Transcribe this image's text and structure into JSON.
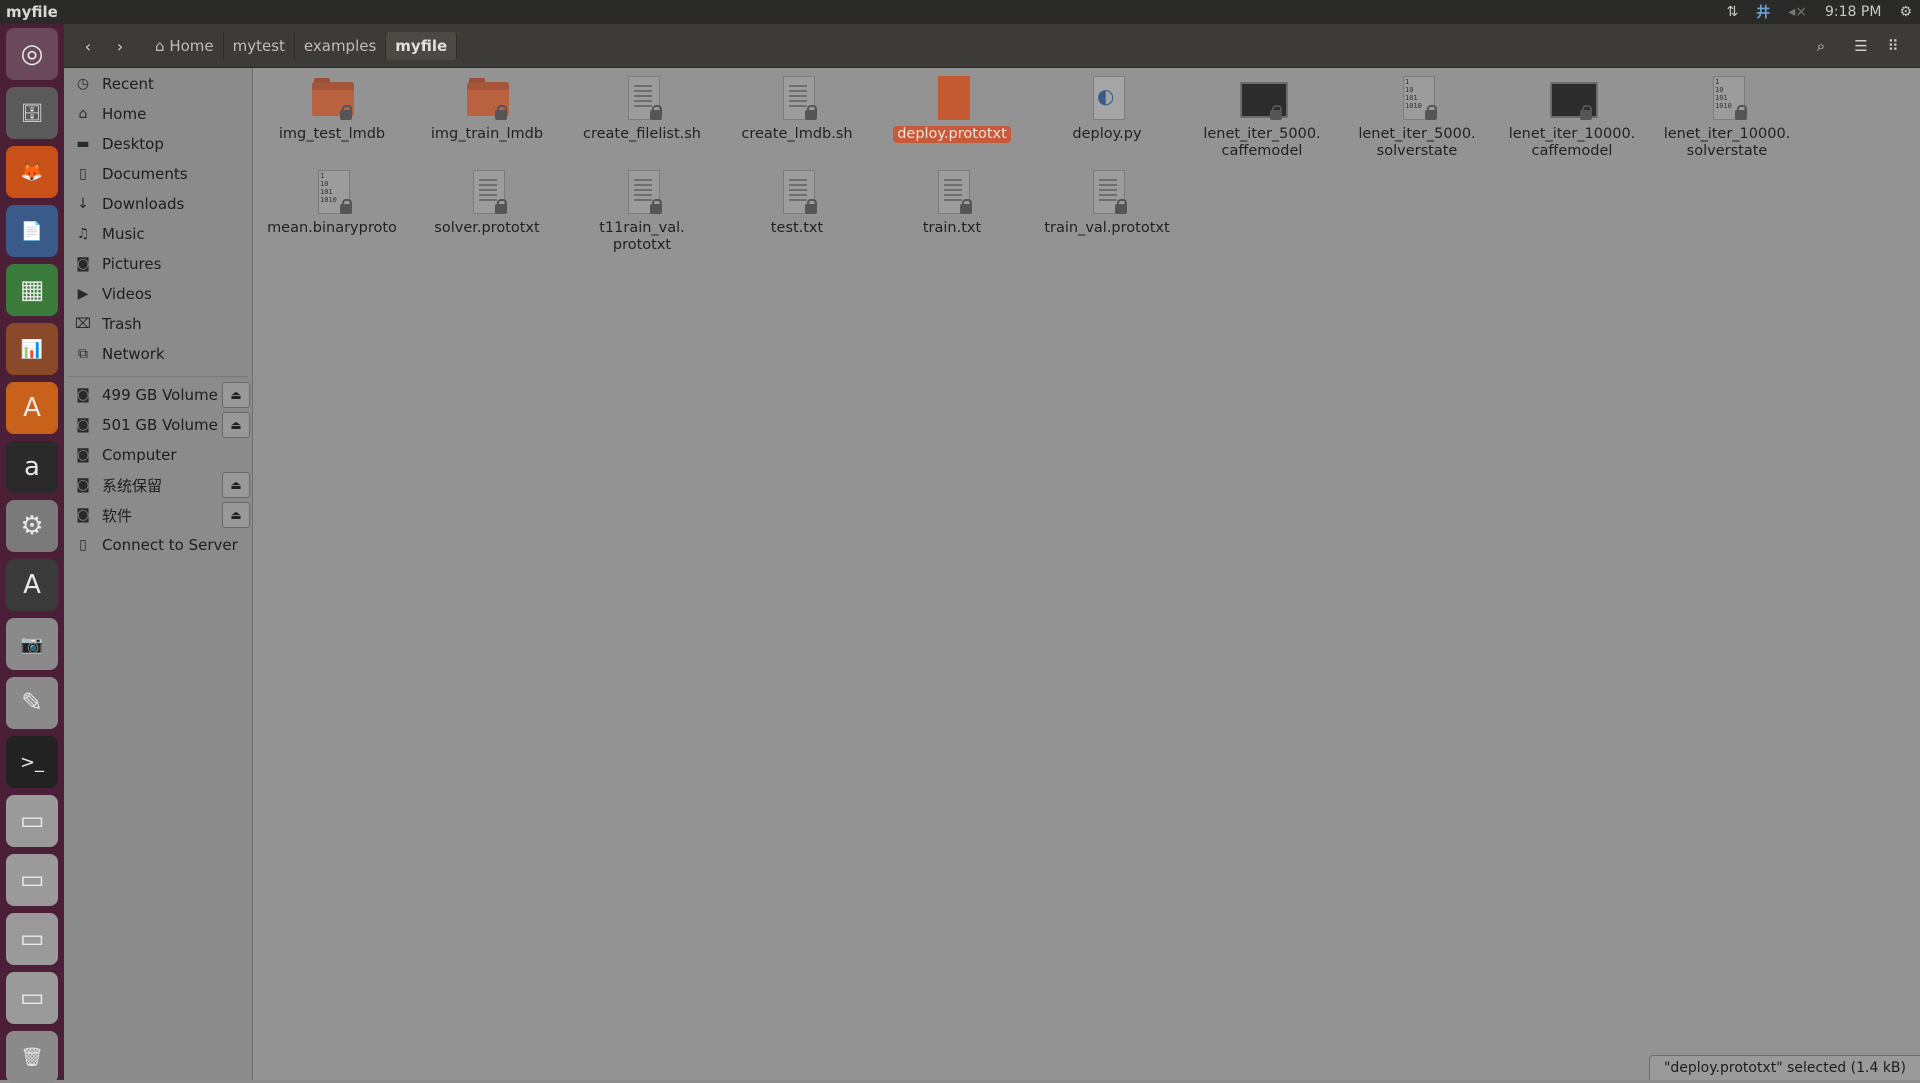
{
  "window": {
    "title": "myfile"
  },
  "tray": {
    "network_icon": "network-updown-icon",
    "input_icon": "keyboard-input-icon",
    "sound_icon": "sound-muted-icon",
    "time": "9:18 PM",
    "settings_icon": "gear-icon"
  },
  "launcher": {
    "items": [
      {
        "name": "ubuntu-dash-icon",
        "glyph": "◎"
      },
      {
        "name": "files-icon",
        "glyph": "🗄"
      },
      {
        "name": "firefox-icon",
        "glyph": "🦊"
      },
      {
        "name": "writer-icon",
        "glyph": "📄"
      },
      {
        "name": "calc-icon",
        "glyph": "▦"
      },
      {
        "name": "impress-icon",
        "glyph": "📊"
      },
      {
        "name": "software-center-icon",
        "glyph": "A"
      },
      {
        "name": "amazon-icon",
        "glyph": "a"
      },
      {
        "name": "system-settings-icon",
        "glyph": "⚙"
      },
      {
        "name": "software-updater-icon",
        "glyph": "A"
      },
      {
        "name": "screenshot-icon",
        "glyph": "📷"
      },
      {
        "name": "text-editor-icon",
        "glyph": "✎"
      },
      {
        "name": "terminal-icon",
        "glyph": ">_"
      },
      {
        "name": "drive-icon",
        "glyph": "▭"
      },
      {
        "name": "drive-icon",
        "glyph": "▭"
      },
      {
        "name": "drive-icon",
        "glyph": "▭"
      },
      {
        "name": "drive-icon",
        "glyph": "▭"
      },
      {
        "name": "trash-icon",
        "glyph": "🗑"
      }
    ]
  },
  "header": {
    "back": "‹",
    "forward": "›",
    "breadcrumbs": [
      {
        "label": "Home",
        "icon": "home-icon"
      },
      {
        "label": "mytest"
      },
      {
        "label": "examples"
      },
      {
        "label": "myfile"
      }
    ],
    "search_icon": "search-icon",
    "list_view_icon": "list-view-icon",
    "grid_view_icon": "grid-view-icon"
  },
  "sidebar": {
    "places": [
      {
        "label": "Recent",
        "icon": "clock-icon",
        "glyph": "◷"
      },
      {
        "label": "Home",
        "icon": "home-icon",
        "glyph": "⌂"
      },
      {
        "label": "Desktop",
        "icon": "desktop-icon",
        "glyph": "▬"
      },
      {
        "label": "Documents",
        "icon": "document-icon",
        "glyph": "▯"
      },
      {
        "label": "Downloads",
        "icon": "download-icon",
        "glyph": "↓"
      },
      {
        "label": "Music",
        "icon": "music-icon",
        "glyph": "♫"
      },
      {
        "label": "Pictures",
        "icon": "camera-icon",
        "glyph": "◙"
      },
      {
        "label": "Videos",
        "icon": "video-icon",
        "glyph": "▶"
      },
      {
        "label": "Trash",
        "icon": "trash-icon",
        "glyph": "⌧"
      },
      {
        "label": "Network",
        "icon": "network-icon",
        "glyph": "⧉"
      }
    ],
    "devices": [
      {
        "label": "499 GB Volume",
        "icon": "drive-icon",
        "eject": true
      },
      {
        "label": "501 GB Volume",
        "icon": "drive-icon",
        "eject": true
      },
      {
        "label": "Computer",
        "icon": "drive-icon",
        "eject": false
      },
      {
        "label": "系统保留",
        "icon": "drive-icon",
        "eject": true
      },
      {
        "label": "软件",
        "icon": "drive-icon",
        "eject": true
      },
      {
        "label": "Connect to Server",
        "icon": "server-icon",
        "eject": false
      }
    ]
  },
  "files": [
    {
      "label": "img_test_lmdb",
      "type": "folder"
    },
    {
      "label": "img_train_lmdb",
      "type": "folder"
    },
    {
      "label": "create_filelist.sh",
      "type": "text"
    },
    {
      "label": "create_lmdb.sh",
      "type": "text"
    },
    {
      "label": "deploy.prototxt",
      "type": "orange",
      "selected": true
    },
    {
      "label": "deploy.py",
      "type": "python"
    },
    {
      "label": "lenet_iter_5000.\ncaffemodel",
      "type": "screen"
    },
    {
      "label": "lenet_iter_5000.\nsolverstate",
      "type": "binary"
    },
    {
      "label": "lenet_iter_10000.\ncaffemodel",
      "type": "screen"
    },
    {
      "label": "lenet_iter_10000.\nsolverstate",
      "type": "binary"
    },
    {
      "label": "mean.binaryproto",
      "type": "binary"
    },
    {
      "label": "solver.prototxt",
      "type": "text"
    },
    {
      "label": "t11rain_val.\nprototxt",
      "type": "text"
    },
    {
      "label": "test.txt",
      "type": "text"
    },
    {
      "label": "train.txt",
      "type": "text"
    },
    {
      "label": "train_val.prototxt",
      "type": "text"
    }
  ],
  "status": {
    "text": "\"deploy.prototxt\" selected  (1.4 kB)"
  }
}
